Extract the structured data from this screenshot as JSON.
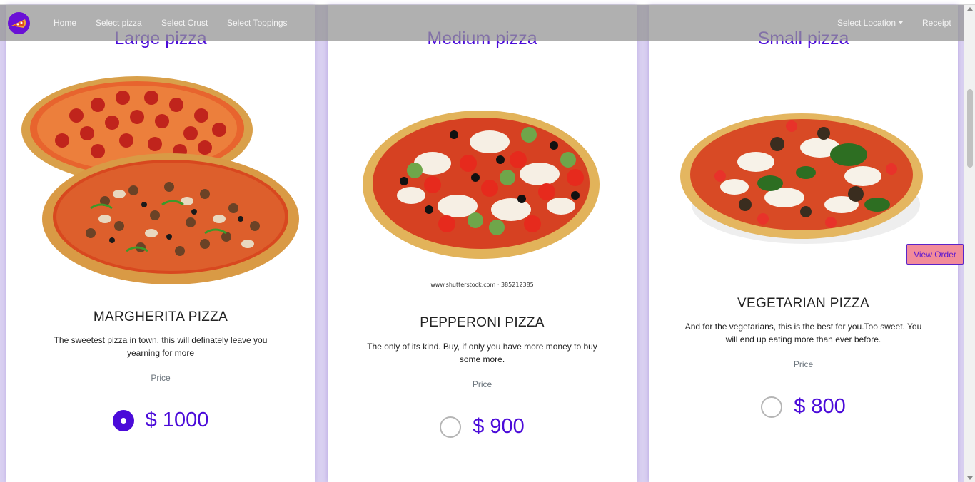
{
  "navbar": {
    "links": [
      "Home",
      "Select pizza",
      "Select Crust",
      "Select Toppings"
    ],
    "location_label": "Select Location",
    "receipt_label": "Receipt"
  },
  "cards": [
    {
      "heading": "Large pizza",
      "name": "MARGHERITA PIZZA",
      "description": "The sweetest pizza in town, this will definately leave you yearning for more",
      "price_label": "Price",
      "price": "$ 1000",
      "selected": true
    },
    {
      "heading": "Medium pizza",
      "name": "PEPPERONI PIZZA",
      "description": "The only of its kind. Buy, if only you have more money to buy some more.",
      "price_label": "Price",
      "price": "$ 900",
      "selected": false,
      "image_caption": "www.shutterstock.com · 385212385"
    },
    {
      "heading": "Small pizza",
      "name": "VEGETARIAN PIZZA",
      "description": "And for the vegetarians, this is the best for you.Too sweet. You will end up eating more than ever before.",
      "price_label": "Price",
      "price": "$ 800",
      "selected": false
    }
  ],
  "view_order_label": "View Order",
  "colors": {
    "accent": "#4b0bd9",
    "background": "#d9d0f1",
    "view_order_bg": "#f28c9a"
  }
}
